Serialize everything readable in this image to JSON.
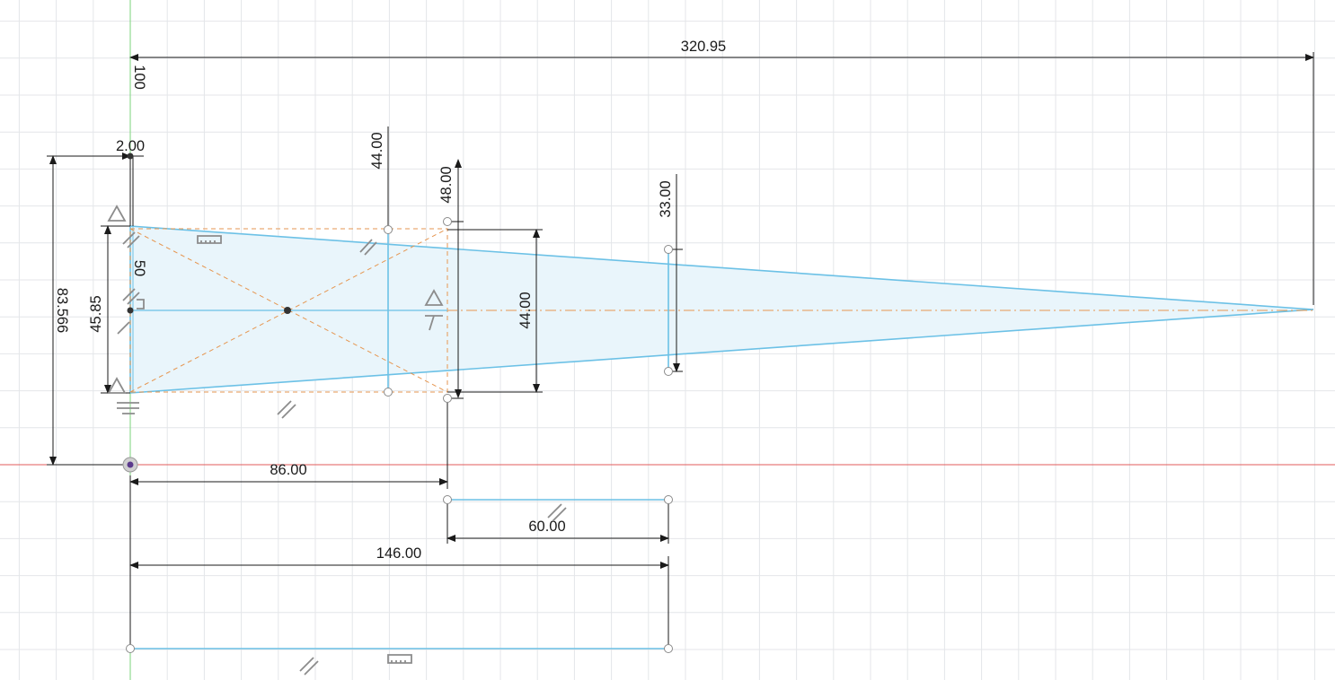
{
  "sketch": {
    "axis_label_vertical": "100",
    "axis_label_inner": "50",
    "dimensions": {
      "total_length": "320.95",
      "offset_small": "2.00",
      "height_outer": "83.566",
      "base_height": "45.85",
      "ref_44_top": "44.00",
      "ref_48": "48.00",
      "ref_33": "33.00",
      "ref_44_side": "44.00",
      "width_86": "86.00",
      "width_60": "60.00",
      "width_146": "146.00"
    },
    "constraint_icons": [
      "coincident-icon",
      "parallel-icon",
      "horizontal-icon",
      "equal-icon",
      "tangent-icon"
    ]
  },
  "colors": {
    "grid": "#e4e6e9",
    "x_axis": "#e25b5b",
    "y_axis": "#7bd37b",
    "sketch_line": "#6cc1e6",
    "profile_fill": "#e9f5fb",
    "construction": "#e69650",
    "dimension": "#1a1a1a",
    "constraint_glyph": "#8c8c8c"
  }
}
